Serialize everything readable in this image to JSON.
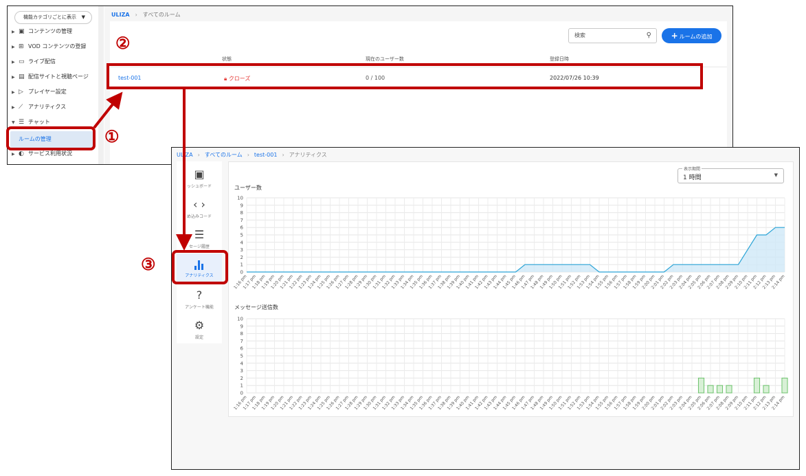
{
  "rooms_window": {
    "sidebar": {
      "category_select": "機能カテゴリごとに表示",
      "items": [
        {
          "label": "コンテンツの管理",
          "icon": "▣"
        },
        {
          "label": "VOD コンテンツの登録",
          "icon": "⊞"
        },
        {
          "label": "ライブ配信",
          "icon": "▭"
        },
        {
          "label": "配信サイトと視聴ページ",
          "icon": "▤"
        },
        {
          "label": "プレイヤー設定",
          "icon": "▷"
        },
        {
          "label": "アナリティクス",
          "icon": "⟋"
        },
        {
          "label": "チャット",
          "icon": "☰"
        },
        {
          "label": "サービス利用状況",
          "icon": "◐"
        }
      ],
      "sub_item": "ルームの管理"
    },
    "breadcrumb": {
      "root": "ULIZA",
      "current": "すべてのルーム"
    },
    "search_placeholder": "検索",
    "add_button": "ルームの追加",
    "table": {
      "headers": [
        "状態",
        "現在のユーザー数",
        "登録日時"
      ],
      "row": {
        "name": "test-001",
        "status": "クローズ",
        "users": "0 / 100",
        "registered": "2022/07/26 10:39"
      }
    }
  },
  "analytics_window": {
    "breadcrumb": {
      "root": "ULIZA",
      "rooms": "すべてのルーム",
      "room": "test-001",
      "current": "アナリティクス"
    },
    "sidebar": [
      {
        "label": "ッシュボード",
        "icon": "dashboard-icon"
      },
      {
        "label": "め込みコード",
        "icon": "code-icon"
      },
      {
        "label": "セージ履歴",
        "icon": "message-icon"
      },
      {
        "label": "アナリティクス",
        "icon": "bar-chart-icon"
      },
      {
        "label": "アンケート機能",
        "icon": "question-icon"
      },
      {
        "label": "設定",
        "icon": "gear-icon"
      }
    ],
    "period": {
      "label": "表示期間",
      "value": "1 時間"
    }
  },
  "annotations": {
    "n1": "①",
    "n2": "②",
    "n3": "③",
    "color": "#c00000"
  },
  "chart_data": [
    {
      "type": "area",
      "title": "ユーザー数",
      "x": [
        "1:16 pm",
        "1:17 pm",
        "1:18 pm",
        "1:19 pm",
        "1:20 pm",
        "1:21 pm",
        "1:22 pm",
        "1:23 pm",
        "1:24 pm",
        "1:25 pm",
        "1:26 pm",
        "1:27 pm",
        "1:28 pm",
        "1:29 pm",
        "1:30 pm",
        "1:31 pm",
        "1:32 pm",
        "1:33 pm",
        "1:34 pm",
        "1:35 pm",
        "1:36 pm",
        "1:37 pm",
        "1:38 pm",
        "1:39 pm",
        "1:40 pm",
        "1:41 pm",
        "1:42 pm",
        "1:43 pm",
        "1:44 pm",
        "1:45 pm",
        "1:46 pm",
        "1:47 pm",
        "1:48 pm",
        "1:49 pm",
        "1:50 pm",
        "1:51 pm",
        "1:52 pm",
        "1:53 pm",
        "1:54 pm",
        "1:55 pm",
        "1:56 pm",
        "1:57 pm",
        "1:58 pm",
        "1:59 pm",
        "2:00 pm",
        "2:01 pm",
        "2:02 pm",
        "2:03 pm",
        "2:04 pm",
        "2:05 pm",
        "2:06 pm",
        "2:07 pm",
        "2:08 pm",
        "2:09 pm",
        "2:10 pm",
        "2:11 pm",
        "2:12 pm",
        "2:13 pm",
        "2:14 pm"
      ],
      "values": [
        0,
        0,
        0,
        0,
        0,
        0,
        0,
        0,
        0,
        0,
        0,
        0,
        0,
        0,
        0,
        0,
        0,
        0,
        0,
        0,
        0,
        0,
        0,
        0,
        0,
        0,
        0,
        0,
        0,
        0,
        1,
        1,
        1,
        1,
        1,
        1,
        1,
        1,
        0,
        0,
        0,
        0,
        0,
        0,
        0,
        0,
        1,
        1,
        1,
        1,
        1,
        1,
        1,
        1,
        3,
        5,
        5,
        6,
        6
      ],
      "ylim": [
        0,
        10
      ],
      "color": "#29a3d6",
      "grid": true
    },
    {
      "type": "bar",
      "title": "メッセージ送信数",
      "x": [
        "1:16 pm",
        "1:17 pm",
        "1:18 pm",
        "1:19 pm",
        "1:20 pm",
        "1:21 pm",
        "1:22 pm",
        "1:23 pm",
        "1:24 pm",
        "1:25 pm",
        "1:26 pm",
        "1:27 pm",
        "1:28 pm",
        "1:29 pm",
        "1:30 pm",
        "1:31 pm",
        "1:32 pm",
        "1:33 pm",
        "1:34 pm",
        "1:35 pm",
        "1:36 pm",
        "1:37 pm",
        "1:38 pm",
        "1:39 pm",
        "1:40 pm",
        "1:41 pm",
        "1:42 pm",
        "1:43 pm",
        "1:44 pm",
        "1:45 pm",
        "1:46 pm",
        "1:47 pm",
        "1:48 pm",
        "1:49 pm",
        "1:50 pm",
        "1:51 pm",
        "1:52 pm",
        "1:53 pm",
        "1:54 pm",
        "1:55 pm",
        "1:56 pm",
        "1:57 pm",
        "1:58 pm",
        "1:59 pm",
        "2:00 pm",
        "2:01 pm",
        "2:02 pm",
        "2:03 pm",
        "2:04 pm",
        "2:05 pm",
        "2:06 pm",
        "2:07 pm",
        "2:08 pm",
        "2:09 pm",
        "2:10 pm",
        "2:11 pm",
        "2:12 pm",
        "2:13 pm",
        "2:14 pm"
      ],
      "values": [
        0,
        0,
        0,
        0,
        0,
        0,
        0,
        0,
        0,
        0,
        0,
        0,
        0,
        0,
        0,
        0,
        0,
        0,
        0,
        0,
        0,
        0,
        0,
        0,
        0,
        0,
        0,
        0,
        0,
        0,
        0,
        0,
        0,
        0,
        0,
        0,
        0,
        0,
        0,
        0,
        0,
        0,
        0,
        0,
        0,
        0,
        0,
        0,
        0,
        2,
        1,
        1,
        1,
        0,
        0,
        2,
        1,
        0,
        2
      ],
      "ylim": [
        0,
        10
      ],
      "color": "#6cc26c",
      "grid": true
    }
  ]
}
